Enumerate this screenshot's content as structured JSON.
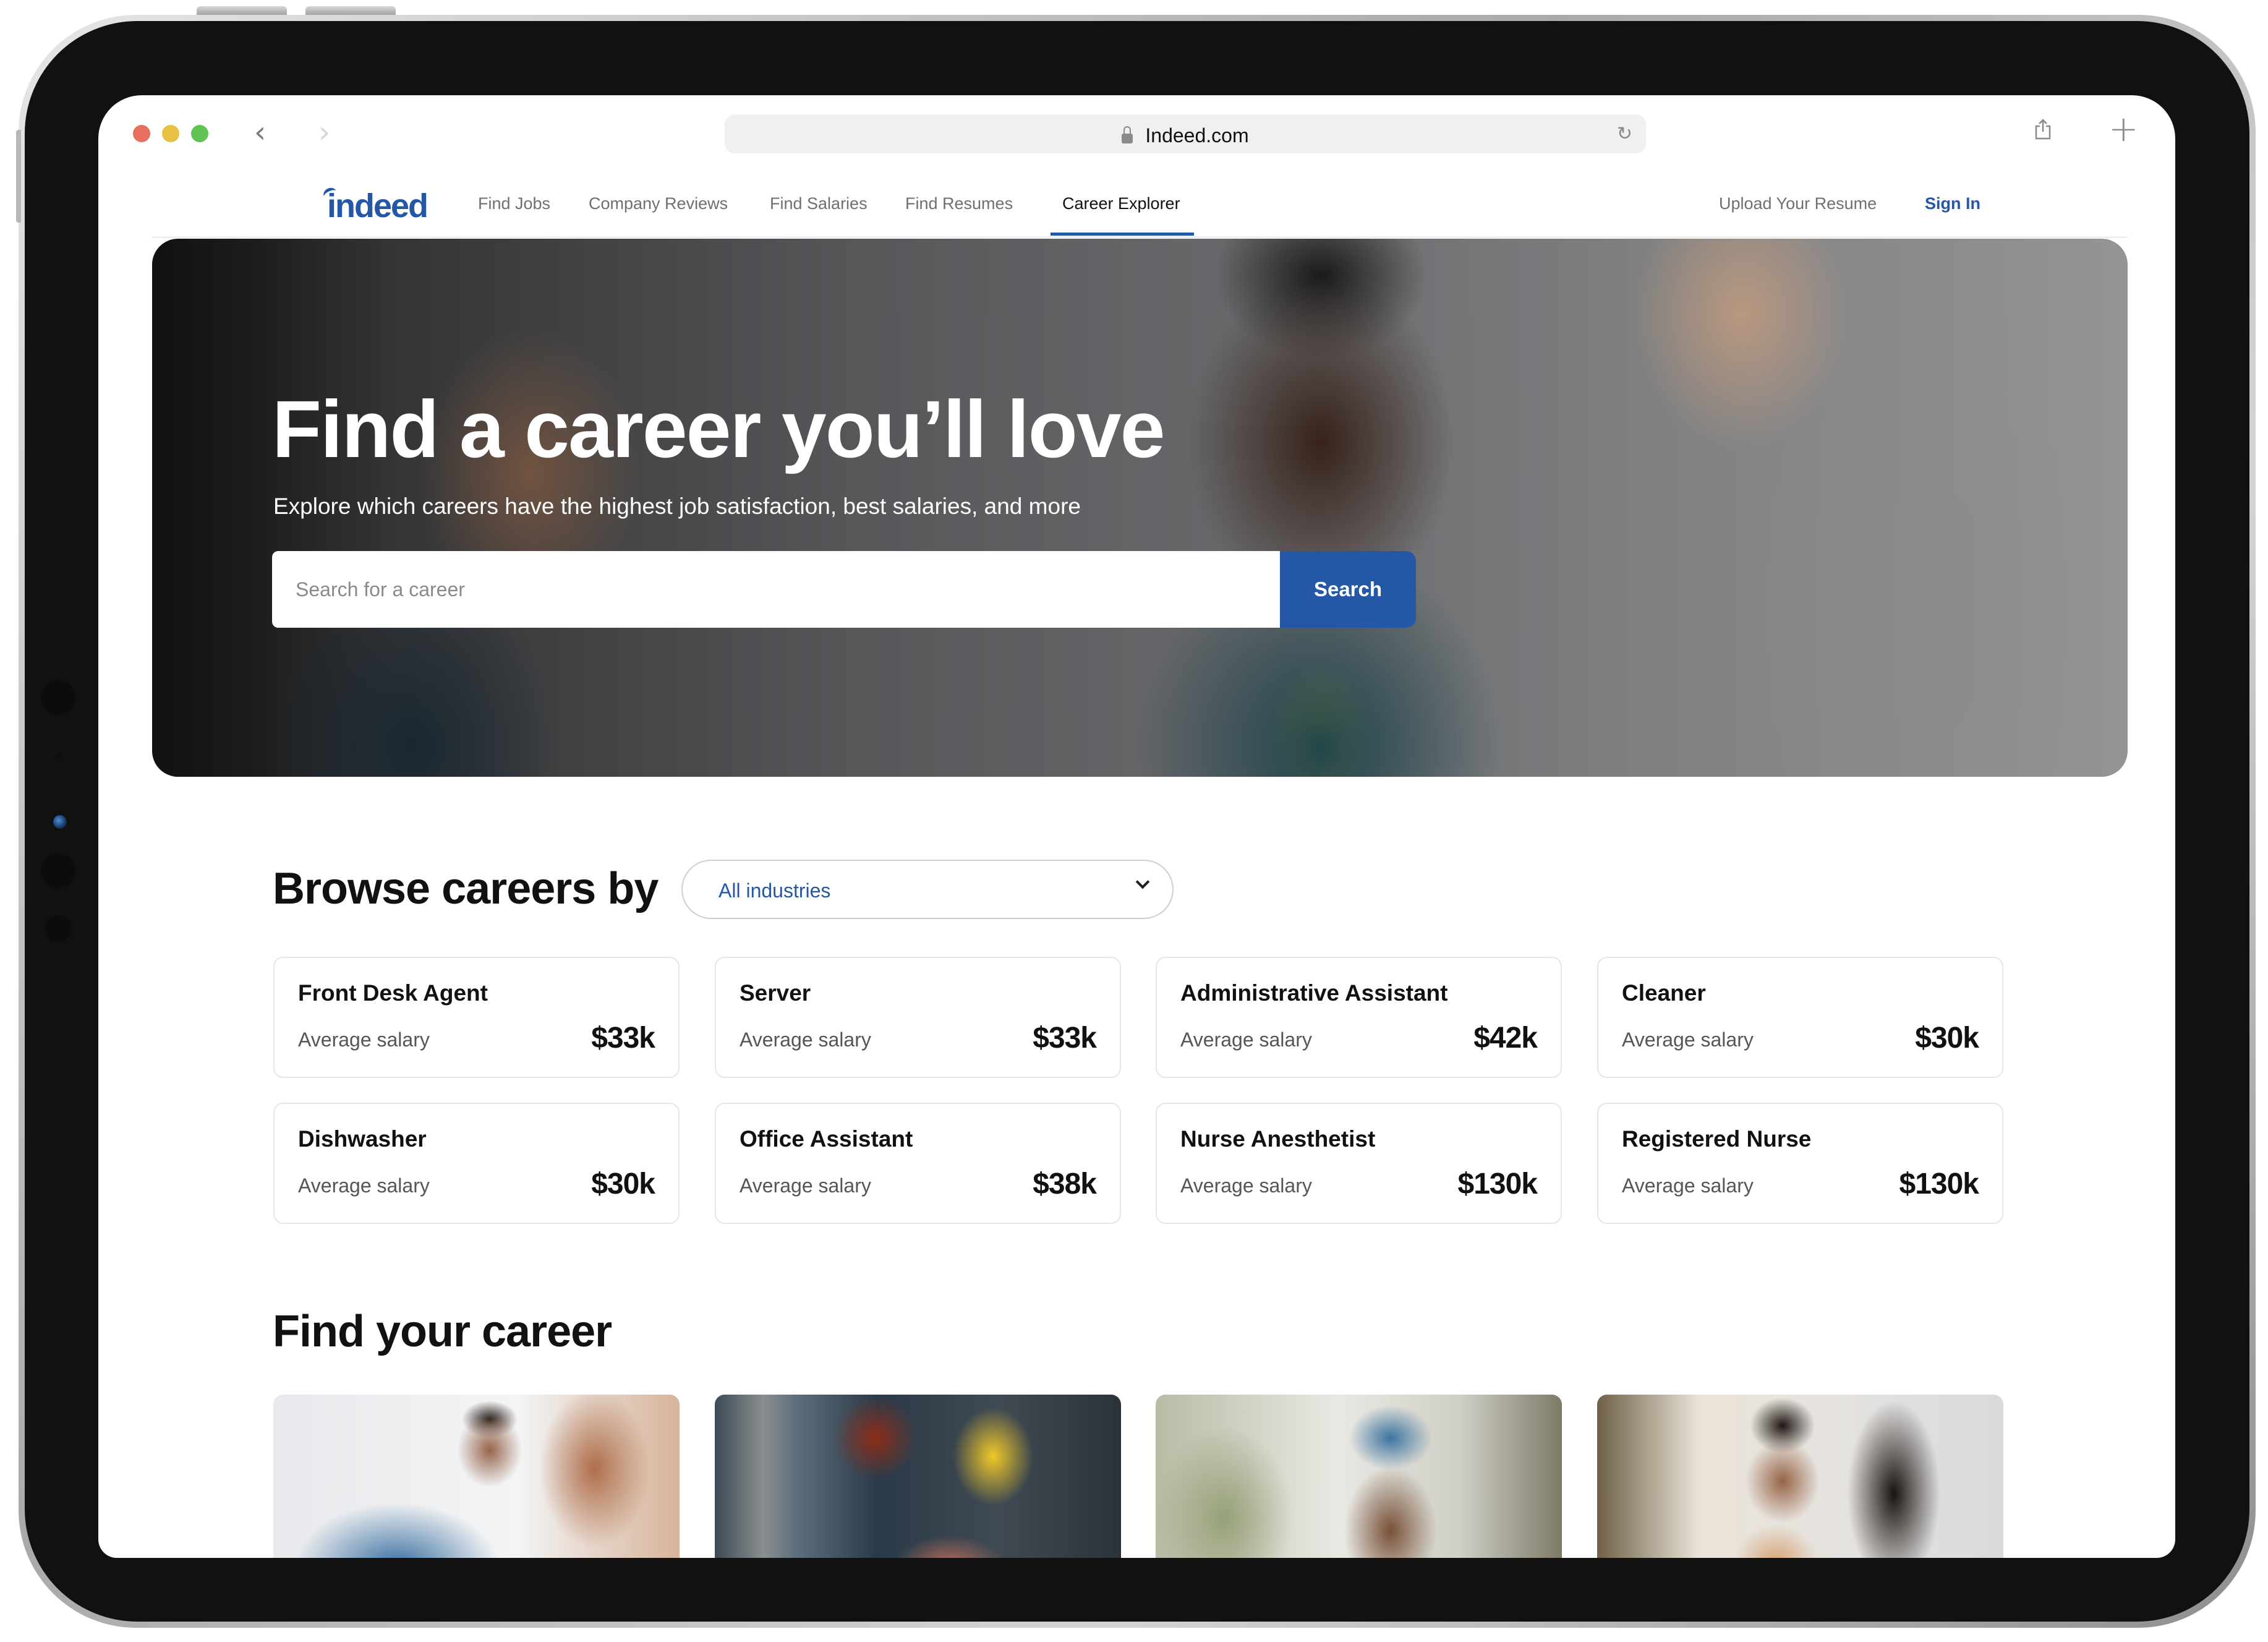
{
  "browser": {
    "url": "Indeed.com",
    "traffic_lights": [
      "#e86f5f",
      "#e8c043",
      "#5fc454"
    ],
    "icons": [
      "back-chevron-icon",
      "forward-chevron-icon",
      "lock-icon",
      "reload-icon",
      "share-icon",
      "new-tab-plus-icon"
    ]
  },
  "site": {
    "logo": "indeed",
    "brand_color": "#2557a7",
    "nav": [
      {
        "label": "Find Jobs",
        "active": false
      },
      {
        "label": "Company Reviews",
        "active": false
      },
      {
        "label": "Find Salaries",
        "active": false
      },
      {
        "label": "Find Resumes",
        "active": false
      },
      {
        "label": "Career Explorer",
        "active": true
      }
    ],
    "upload_resume": "Upload Your Resume",
    "sign_in": "Sign In"
  },
  "hero": {
    "title": "Find a career you’ll love",
    "subtitle": "Explore which careers have the highest job satisfaction, best salaries, and more",
    "search_placeholder": "Search for a career",
    "search_button": "Search"
  },
  "browse": {
    "heading": "Browse careers by",
    "dropdown_value": "All industries",
    "cards": [
      {
        "title": "Front Desk Agent",
        "label": "Average salary",
        "salary": "$33k"
      },
      {
        "title": "Server",
        "label": "Average salary",
        "salary": "$33k"
      },
      {
        "title": "Administrative Assistant",
        "label": "Average salary",
        "salary": "$42k"
      },
      {
        "title": "Cleaner",
        "label": "Average salary",
        "salary": "$30k"
      },
      {
        "title": "Dishwasher",
        "label": "Average salary",
        "salary": "$30k"
      },
      {
        "title": "Office Assistant",
        "label": "Average salary",
        "salary": "$38k"
      },
      {
        "title": "Nurse Anesthetist",
        "label": "Average salary",
        "salary": "$130k"
      },
      {
        "title": "Registered Nurse",
        "label": "Average salary",
        "salary": "$130k"
      }
    ]
  },
  "find_career": {
    "heading": "Find your career",
    "photos": [
      "nurse-with-patient-photo",
      "electrician-hard-hat-photo",
      "delivery-driver-cap-photo",
      "couple-reviewing-photo"
    ]
  }
}
